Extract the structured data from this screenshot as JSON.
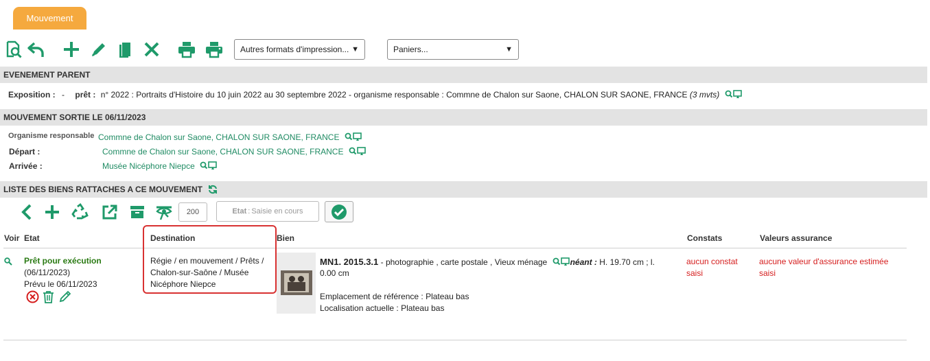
{
  "tab": {
    "label": "Mouvement"
  },
  "toolbar": {
    "print_formats_select": "Autres formats d'impression...",
    "baskets_select": "Paniers..."
  },
  "parent_event": {
    "header": "EVENEMENT PARENT",
    "exposition_label": "Exposition :",
    "exposition_value": "-",
    "pret_label": "prêt :",
    "pret_value": "n° 2022 : Portraits d'Histoire du 10 juin 2022 au 30 septembre 2022 - organisme responsable : Commne de Chalon sur Saone, CHALON SUR SAONE, FRANCE",
    "pret_count": "(3 mvts)"
  },
  "movement": {
    "header": "MOUVEMENT SORTIE LE 06/11/2023",
    "organisme_label": "Organisme responsable",
    "organisme_value": "Commne de Chalon sur Saone, CHALON SUR SAONE, FRANCE",
    "depart_label": "Départ :",
    "depart_value": "Commne de Chalon sur Saone, CHALON SUR SAONE, FRANCE",
    "arrivee_label": "Arrivée :",
    "arrivee_value": "Musée Nicéphore Niepce"
  },
  "items_list": {
    "header": "LISTE DES BIENS RATTACHES A CE MOUVEMENT",
    "page_size": "200",
    "etat_label": "Etat",
    "etat_placeholder": "Saisie en cours",
    "columns": {
      "voir": "Voir",
      "etat": "Etat",
      "destination": "Destination",
      "bien": "Bien",
      "constats": "Constats",
      "valeurs": "Valeurs assurance"
    },
    "rows": [
      {
        "status": "Prêt pour exécution",
        "status_date": "(06/11/2023)",
        "planned": "Prévu le 06/11/2023",
        "destination_line1": "Régie / en mouvement / Prêts /",
        "destination_line2": "Chalon-sur-Saône / Musée",
        "destination_line3": "Nicéphore Niepce",
        "bien_id": "MN1. 2015.3.1",
        "bien_desc": " - photographie , carte postale , Vieux ménage",
        "bien_neant": "néant :",
        "bien_dims": " H. 19.70 cm ;  l.",
        "bien_dims2": "0.00 cm",
        "emplacement": "Emplacement de référence : Plateau bas",
        "localisation": "Localisation actuelle : Plateau bas",
        "constats": "aucun constat",
        "constats2": "saisi",
        "valeurs": "aucune valeur d'assurance estimée",
        "valeurs2": "saisi"
      }
    ]
  },
  "colors": {
    "accent_orange": "#f5a93e",
    "icon_green": "#1f9a6a",
    "link_green": "#1f8b63",
    "alert_red": "#d51d1d",
    "highlight_box": "#d83131"
  }
}
